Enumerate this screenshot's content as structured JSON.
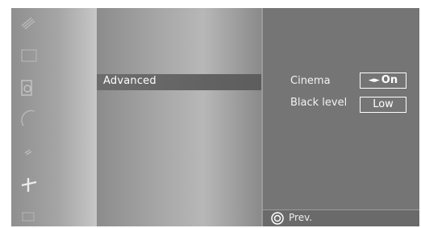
{
  "menu": {
    "icons": [
      "picture-icon",
      "screen-icon",
      "sound-icon",
      "time-icon",
      "option-icon",
      "setup-icon",
      "input-icon"
    ]
  },
  "submenu": {
    "selected_label": "Advanced"
  },
  "panel": {
    "rows": [
      {
        "label": "Cinema",
        "value": "On",
        "arrows": "◄►"
      },
      {
        "label": "Black level",
        "value": "Low"
      }
    ]
  },
  "footer": {
    "prev_label": "Prev."
  },
  "colors": {
    "text": "#ffffff",
    "panel_bg": "#757575",
    "highlight_bg": "#5d5d5d"
  }
}
